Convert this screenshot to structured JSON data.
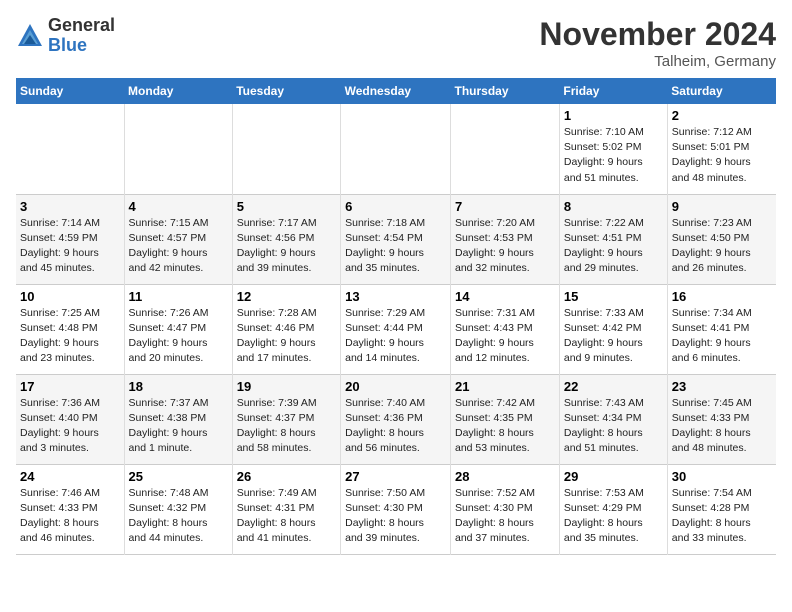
{
  "header": {
    "logo_general": "General",
    "logo_blue": "Blue",
    "month_title": "November 2024",
    "location": "Talheim, Germany"
  },
  "weekdays": [
    "Sunday",
    "Monday",
    "Tuesday",
    "Wednesday",
    "Thursday",
    "Friday",
    "Saturday"
  ],
  "weeks": [
    [
      {
        "day": "",
        "info": ""
      },
      {
        "day": "",
        "info": ""
      },
      {
        "day": "",
        "info": ""
      },
      {
        "day": "",
        "info": ""
      },
      {
        "day": "",
        "info": ""
      },
      {
        "day": "1",
        "info": "Sunrise: 7:10 AM\nSunset: 5:02 PM\nDaylight: 9 hours\nand 51 minutes."
      },
      {
        "day": "2",
        "info": "Sunrise: 7:12 AM\nSunset: 5:01 PM\nDaylight: 9 hours\nand 48 minutes."
      }
    ],
    [
      {
        "day": "3",
        "info": "Sunrise: 7:14 AM\nSunset: 4:59 PM\nDaylight: 9 hours\nand 45 minutes."
      },
      {
        "day": "4",
        "info": "Sunrise: 7:15 AM\nSunset: 4:57 PM\nDaylight: 9 hours\nand 42 minutes."
      },
      {
        "day": "5",
        "info": "Sunrise: 7:17 AM\nSunset: 4:56 PM\nDaylight: 9 hours\nand 39 minutes."
      },
      {
        "day": "6",
        "info": "Sunrise: 7:18 AM\nSunset: 4:54 PM\nDaylight: 9 hours\nand 35 minutes."
      },
      {
        "day": "7",
        "info": "Sunrise: 7:20 AM\nSunset: 4:53 PM\nDaylight: 9 hours\nand 32 minutes."
      },
      {
        "day": "8",
        "info": "Sunrise: 7:22 AM\nSunset: 4:51 PM\nDaylight: 9 hours\nand 29 minutes."
      },
      {
        "day": "9",
        "info": "Sunrise: 7:23 AM\nSunset: 4:50 PM\nDaylight: 9 hours\nand 26 minutes."
      }
    ],
    [
      {
        "day": "10",
        "info": "Sunrise: 7:25 AM\nSunset: 4:48 PM\nDaylight: 9 hours\nand 23 minutes."
      },
      {
        "day": "11",
        "info": "Sunrise: 7:26 AM\nSunset: 4:47 PM\nDaylight: 9 hours\nand 20 minutes."
      },
      {
        "day": "12",
        "info": "Sunrise: 7:28 AM\nSunset: 4:46 PM\nDaylight: 9 hours\nand 17 minutes."
      },
      {
        "day": "13",
        "info": "Sunrise: 7:29 AM\nSunset: 4:44 PM\nDaylight: 9 hours\nand 14 minutes."
      },
      {
        "day": "14",
        "info": "Sunrise: 7:31 AM\nSunset: 4:43 PM\nDaylight: 9 hours\nand 12 minutes."
      },
      {
        "day": "15",
        "info": "Sunrise: 7:33 AM\nSunset: 4:42 PM\nDaylight: 9 hours\nand 9 minutes."
      },
      {
        "day": "16",
        "info": "Sunrise: 7:34 AM\nSunset: 4:41 PM\nDaylight: 9 hours\nand 6 minutes."
      }
    ],
    [
      {
        "day": "17",
        "info": "Sunrise: 7:36 AM\nSunset: 4:40 PM\nDaylight: 9 hours\nand 3 minutes."
      },
      {
        "day": "18",
        "info": "Sunrise: 7:37 AM\nSunset: 4:38 PM\nDaylight: 9 hours\nand 1 minute."
      },
      {
        "day": "19",
        "info": "Sunrise: 7:39 AM\nSunset: 4:37 PM\nDaylight: 8 hours\nand 58 minutes."
      },
      {
        "day": "20",
        "info": "Sunrise: 7:40 AM\nSunset: 4:36 PM\nDaylight: 8 hours\nand 56 minutes."
      },
      {
        "day": "21",
        "info": "Sunrise: 7:42 AM\nSunset: 4:35 PM\nDaylight: 8 hours\nand 53 minutes."
      },
      {
        "day": "22",
        "info": "Sunrise: 7:43 AM\nSunset: 4:34 PM\nDaylight: 8 hours\nand 51 minutes."
      },
      {
        "day": "23",
        "info": "Sunrise: 7:45 AM\nSunset: 4:33 PM\nDaylight: 8 hours\nand 48 minutes."
      }
    ],
    [
      {
        "day": "24",
        "info": "Sunrise: 7:46 AM\nSunset: 4:33 PM\nDaylight: 8 hours\nand 46 minutes."
      },
      {
        "day": "25",
        "info": "Sunrise: 7:48 AM\nSunset: 4:32 PM\nDaylight: 8 hours\nand 44 minutes."
      },
      {
        "day": "26",
        "info": "Sunrise: 7:49 AM\nSunset: 4:31 PM\nDaylight: 8 hours\nand 41 minutes."
      },
      {
        "day": "27",
        "info": "Sunrise: 7:50 AM\nSunset: 4:30 PM\nDaylight: 8 hours\nand 39 minutes."
      },
      {
        "day": "28",
        "info": "Sunrise: 7:52 AM\nSunset: 4:30 PM\nDaylight: 8 hours\nand 37 minutes."
      },
      {
        "day": "29",
        "info": "Sunrise: 7:53 AM\nSunset: 4:29 PM\nDaylight: 8 hours\nand 35 minutes."
      },
      {
        "day": "30",
        "info": "Sunrise: 7:54 AM\nSunset: 4:28 PM\nDaylight: 8 hours\nand 33 minutes."
      }
    ]
  ]
}
